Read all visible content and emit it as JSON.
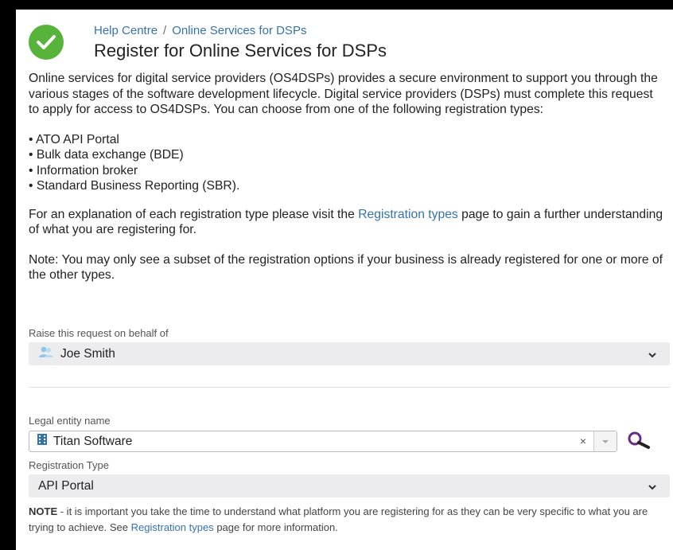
{
  "header": {
    "breadcrumb_home": "Help Centre",
    "breadcrumb_separator": "/",
    "breadcrumb_current": "Online Services for DSPs",
    "title": "Register for Online Services for DSPs"
  },
  "intro": {
    "paragraph": "Online services for digital service providers (OS4DSPs) provides a secure environment to support you through the various stages of the software development lifecycle. Digital service providers (DSPs) must complete this request to apply for access to OS4DSPs. You can choose from one of the following registration types:",
    "types": [
      "ATO API Portal",
      "Bulk data exchange (BDE)",
      "Information broker",
      "Standard Business Reporting (SBR)."
    ],
    "explain_prefix": "For an explanation of each registration type please visit the ",
    "explain_link": "Registration types",
    "explain_suffix": " page to gain a further understanding of what you are registering for.",
    "note": "Note: You may only see a subset of the registration options if your business is already registered for one or more of the other types."
  },
  "form": {
    "behalf_label": "Raise this request on behalf of",
    "behalf_value": "Joe Smith",
    "entity_label": "Legal entity name",
    "entity_value": "Titan Software",
    "clear_glyph": "×",
    "reg_type_label": "Registration Type",
    "reg_type_value": "API Portal"
  },
  "footer_note": {
    "bold": "NOTE",
    "text1": " - it is important you take the time to understand what platform you are registering for as they can be very specific to what you are trying to achieve. See ",
    "link": "Registration types",
    "text2": " page for more information."
  },
  "colors": {
    "brand_green": "#58b33a",
    "link_blue": "#3572b0"
  },
  "icons": {
    "logo": "check-circle-icon",
    "user": "user-icon",
    "entity": "building-icon",
    "chevron": "chevron-down-icon",
    "search": "search-icon"
  }
}
